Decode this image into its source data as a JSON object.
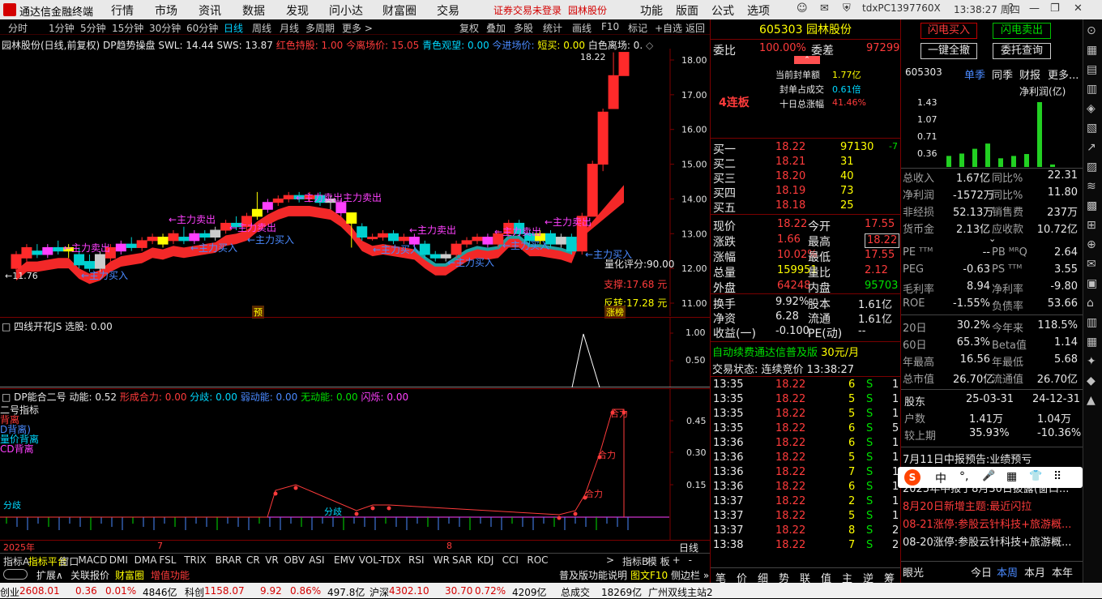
{
  "titlebar": {
    "app_title": "通达信金融终端",
    "menus": [
      "行情",
      "市场",
      "资讯",
      "数据",
      "发现",
      "问小达",
      "财富圈",
      "交易"
    ],
    "warning": "证券交易未登录",
    "stock_link": "园林股份",
    "right_menus": [
      "功能",
      "版面",
      "公式",
      "选项"
    ],
    "host": "tdxPC1397760X",
    "clock": "13:38:27 周四"
  },
  "toolbar": {
    "periods": [
      "分时",
      "1分钟",
      "5分钟",
      "15分钟",
      "30分钟",
      "60分钟",
      "日线",
      "周线",
      "月线",
      "多周期",
      "更多 >"
    ],
    "selected_period": "日线",
    "right_items": [
      "复权",
      "叠加",
      "多股",
      "统计",
      "画线",
      "F10",
      "标记",
      "+自选",
      "返回"
    ]
  },
  "chart_header": {
    "name": "园林股份(日线,前复权)",
    "indicator": "DP趋势操盘",
    "swl": "SWL: 14.44",
    "sws": "SWS: 13.87",
    "hold": "红色持股: 1.00",
    "exit_price": "今离场价: 15.05",
    "watch": "青色观望: 0.00",
    "enter_price": "今进场价:",
    "short": "短买: 0.00",
    "white_exit": "白色离场: 0.",
    "icons": "◇"
  },
  "main_chart_labels": {
    "price_top": "18.22",
    "price_low": "←11.76",
    "score": "量化评分:90.00",
    "resist": "支撑:17.68 元",
    "reverse": "反转:17.28 元",
    "limit_badge": "涨榜",
    "pre_badge": "预",
    "main_sell": "←主力卖出",
    "main_buy": "←主力买入",
    "main_sell_multi": "←主力卖出主力卖出"
  },
  "y_axis_main": [
    "18.00",
    "17.00",
    "16.00",
    "15.00",
    "14.00",
    "13.00",
    "12.00",
    "11.00"
  ],
  "sub1": {
    "title": "四线开花JS",
    "value": "选股: 0.00",
    "y_axis": [
      "1.00",
      "0.50"
    ]
  },
  "sub2": {
    "title": "DP能合二号",
    "dong": "动能: 0.52",
    "he": "形成合力: 0.00",
    "fen": "分歧: 0.00",
    "ruo": "弱动能: 0.00",
    "wu": "无动能: 0.00",
    "flash": "闪烁: 0.00",
    "legend": [
      "二号指标",
      "背离",
      "D背离)",
      "量价背离",
      "CD背离"
    ],
    "y_axis": [
      "0.45",
      "0.30",
      "0.15"
    ],
    "labels": [
      "分歧",
      "分歧",
      "合力",
      "合力",
      "合力"
    ]
  },
  "x_axis": [
    "2025年",
    "7",
    "8"
  ],
  "daily_label": "日线",
  "quote": {
    "code": "605303",
    "name": "园林股份",
    "wei_bi_label": "委比",
    "wei_bi": "100.00%",
    "wei_cha_label": "委差",
    "wei_cha": "97299",
    "streak": "4连板",
    "seal_amount_label": "当前封单额",
    "seal_amount": "1.77亿",
    "seal_ratio_label": "封单占成交",
    "seal_ratio": "0.61倍",
    "ten_day_label": "十日总涨幅",
    "ten_day": "41.46%",
    "bids": [
      {
        "label": "买一",
        "price": "18.22",
        "vol": "97130",
        "chg": "-7"
      },
      {
        "label": "买二",
        "price": "18.21",
        "vol": "31",
        "chg": ""
      },
      {
        "label": "买三",
        "price": "18.20",
        "vol": "40",
        "chg": ""
      },
      {
        "label": "买四",
        "price": "18.19",
        "vol": "73",
        "chg": ""
      },
      {
        "label": "买五",
        "price": "18.18",
        "vol": "25",
        "chg": ""
      }
    ],
    "stats": [
      {
        "l1": "现价",
        "v1": "18.22",
        "l2": "今开",
        "v2": "17.55"
      },
      {
        "l1": "涨跌",
        "v1": "1.66",
        "l2": "最高",
        "v2": "18.22"
      },
      {
        "l1": "涨幅",
        "v1": "10.02%",
        "l2": "最低",
        "v2": "17.55"
      },
      {
        "l1": "总量",
        "v1": "159951",
        "l2": "量比",
        "v2": "2.12"
      },
      {
        "l1": "外盘",
        "v1": "64248",
        "l2": "内盘",
        "v2": "95703"
      }
    ],
    "stats2": [
      {
        "l1": "换手",
        "v1": "9.92%",
        "l2": "股本",
        "v2": "1.61亿"
      },
      {
        "l1": "净资",
        "v1": "6.28",
        "l2": "流通",
        "v2": "1.61亿"
      },
      {
        "l1": "收益(一)",
        "v1": "-0.100",
        "l2": "PE(动)",
        "v2": "--"
      }
    ],
    "promo": "自动续费通达信普及版",
    "promo_price": "30元/月",
    "status": "交易状态: 连续竞价 13:38:27",
    "ticks": [
      {
        "t": "13:35",
        "p": "18.22",
        "v": "6",
        "s": "S",
        "n": "1"
      },
      {
        "t": "13:35",
        "p": "18.22",
        "v": "5",
        "s": "S",
        "n": "1"
      },
      {
        "t": "13:35",
        "p": "18.22",
        "v": "5",
        "s": "S",
        "n": "1"
      },
      {
        "t": "13:35",
        "p": "18.22",
        "v": "6",
        "s": "S",
        "n": "5"
      },
      {
        "t": "13:36",
        "p": "18.22",
        "v": "6",
        "s": "S",
        "n": "1"
      },
      {
        "t": "13:36",
        "p": "18.22",
        "v": "5",
        "s": "S",
        "n": "1"
      },
      {
        "t": "13:36",
        "p": "18.22",
        "v": "7",
        "s": "S",
        "n": "1"
      },
      {
        "t": "13:36",
        "p": "18.22",
        "v": "6",
        "s": "S",
        "n": "1"
      },
      {
        "t": "13:37",
        "p": "18.22",
        "v": "2",
        "s": "S",
        "n": "1"
      },
      {
        "t": "13:37",
        "p": "18.22",
        "v": "5",
        "s": "S",
        "n": "1"
      },
      {
        "t": "13:37",
        "p": "18.22",
        "v": "8",
        "s": "S",
        "n": "2"
      },
      {
        "t": "13:38",
        "p": "18.22",
        "v": "7",
        "s": "S",
        "n": "2"
      }
    ],
    "bottom_tabs": [
      "笔",
      "价",
      "细",
      "势",
      "联",
      "值",
      "主",
      "逆",
      "筹"
    ]
  },
  "fin": {
    "buy_btn": "闪电买入",
    "sell_btn": "闪电卖出",
    "all_cancel": "一键全撤",
    "order_query": "委托查询",
    "code": "605303",
    "tabs": [
      "单季",
      "同季",
      "财报",
      "更多..."
    ],
    "chart_title": "净利润(亿)",
    "chart_y": [
      "1.43",
      "1.07",
      "0.71",
      "0.36",
      "0.00"
    ],
    "chart_x": [
      "2023",
      "2024",
      "2025"
    ],
    "rows": [
      {
        "l1": "总收入",
        "v1": "1.67亿",
        "l2": "同比%",
        "v2": "22.31"
      },
      {
        "l1": "净利润",
        "v1": "-1572万",
        "l2": "同比%",
        "v2": "11.80"
      },
      {
        "l1": "非经损",
        "v1": "52.13万",
        "l2": "销售费",
        "v2": "237万"
      },
      {
        "l1": "货币金",
        "v1": "2.13亿",
        "l2": "应收款",
        "v2": "10.72亿"
      }
    ],
    "rows2": [
      {
        "l1": "PE ᵀᵀᴹ",
        "v1": "--",
        "l2": "PB ᴹᴿQ",
        "v2": "2.64"
      },
      {
        "l1": "PEG",
        "v1": "-0.63",
        "l2": "PS ᵀᵀᴹ",
        "v2": "3.55"
      },
      {
        "l1": "毛利率",
        "v1": "8.94",
        "l2": "净利率",
        "v2": "-9.80"
      },
      {
        "l1": "ROE",
        "v1": "-1.55%",
        "l2": "负债率",
        "v2": "53.66"
      }
    ],
    "rows3": [
      {
        "l1": "20日",
        "v1": "30.2%",
        "l2": "今年来",
        "v2": "118.5%"
      },
      {
        "l1": "60日",
        "v1": "65.3%",
        "l2": "Beta值",
        "v2": "1.14"
      },
      {
        "l1": "年最高",
        "v1": "16.56",
        "l2": "年最低",
        "v2": "5.68"
      },
      {
        "l1": "总市值",
        "v1": "26.70亿",
        "l2": "流通值",
        "v2": "26.70亿"
      }
    ],
    "holders": {
      "label": "股东",
      "d1": "25-03-31",
      "d2": "24-12-31"
    },
    "holders_rows": [
      {
        "l": "户数",
        "v1": "1.41万",
        "v2": "1.04万"
      },
      {
        "l": "较上期",
        "v1": "35.93%",
        "v2": "-10.36%"
      }
    ],
    "news": [
      "7月11日中报预告:业绩预亏",
      "2025年中报于8月30日披露(窗口...",
      "8月20日新增主题:最近闪拉",
      "08-21涨停:参股云针科技+旅游概...",
      "08-20涨停:参股云针科技+旅游概..."
    ],
    "bottom": [
      "眼光",
      "今日",
      "本周",
      "本月",
      "本年"
    ]
  },
  "floatbar": [
    "中",
    "°,",
    "🎤",
    "▦",
    "👕",
    "⠿"
  ],
  "tabs": [
    "指标A",
    "指标平台",
    "窗口",
    "MACD",
    "DMI",
    "DMA",
    "FSL",
    "TRIX",
    "BRAR",
    "CR",
    "VR",
    "OBV",
    "ASI",
    "EMV",
    "VOL-TDX",
    "RSI",
    "WR",
    "SAR",
    "KDJ",
    "CCI",
    "ROC",
    ">",
    "指标B",
    "模 板",
    "+",
    "-"
  ],
  "tabs2": [
    "扩展∧",
    "关联报价",
    "财富圈",
    "增值功能"
  ],
  "tabs2_right": [
    "普及版功能说明",
    "图文F10",
    "侧边栏 »"
  ],
  "statusbar": [
    {
      "l": "创业",
      "v": "2608.01",
      "c": "0.36",
      "p": "0.01%",
      "a": "4846亿"
    },
    {
      "l": "科创",
      "v": "1158.07",
      "c": "9.92",
      "p": "0.86%",
      "a": "497.8亿"
    },
    {
      "l": "沪深",
      "v": "4302.10",
      "c": "30.70",
      "p": "0.72%",
      "a": "4209亿"
    }
  ],
  "status_total_label": "总成交",
  "status_total": "18269亿",
  "status_server": "广州双线主站2",
  "colors": {
    "up": "#ff3b3b",
    "down": "#00e000",
    "accent": "#ffff00",
    "band": "#ff3030"
  }
}
